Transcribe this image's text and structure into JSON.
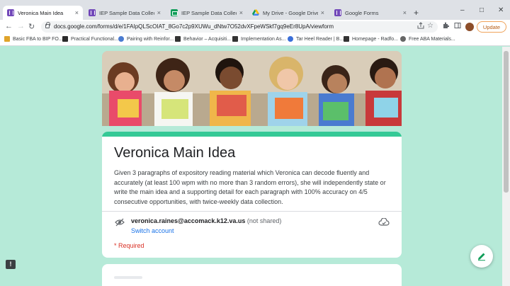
{
  "browser": {
    "tabs": [
      {
        "title": "Veronica Main Idea",
        "icon": "google-forms-icon",
        "active": true
      },
      {
        "title": "IEP Sample Data Collection",
        "icon": "google-forms-icon"
      },
      {
        "title": "IEP Sample Data Collection (",
        "icon": "google-sheets-icon"
      },
      {
        "title": "My Drive - Google Drive",
        "icon": "google-drive-icon"
      },
      {
        "title": "Google Forms",
        "icon": "google-forms-icon"
      }
    ],
    "tab_close": "×",
    "new_tab": "+",
    "window_controls": {
      "minimize": "–",
      "maximize": "□",
      "close": "✕"
    },
    "nav": {
      "back": "←",
      "forward": "→",
      "reload": "↻"
    },
    "url": "docs.google.com/forms/d/e/1FAIpQLScOIAT_8Go7c2p9XUWu_dNtw7O52dvXFpeWSkf7gq9eEr8UpA/viewform",
    "update_label": "Update",
    "bookmarks": [
      {
        "label": "Basic FBA to BIP FO...",
        "color": "#e0a42b"
      },
      {
        "label": "Practical Functional...",
        "color": "#2b2b2b"
      },
      {
        "label": "Pairing with Reinfor...",
        "color": "#4a7bd0"
      },
      {
        "label": "Behavior – Acquisiti...",
        "color": "#333333"
      },
      {
        "label": "Implementation As...",
        "color": "#333333"
      },
      {
        "label": "Tar Heel Reader | B...",
        "color": "#3b6fd8"
      },
      {
        "label": "Homepage - Radfo...",
        "color": "#333333"
      },
      {
        "label": "Free ABA Materials...",
        "color": "#666666"
      }
    ]
  },
  "form": {
    "title": "Veronica Main Idea",
    "description": "Given 3 paragraphs of expository reading material which Veronica can decode fluently and accurately (at least 100 wpm with no more than 3 random errors), she will independently state or write the main idea and a supporting detail for each paragraph with 100% accuracy on 4/5 consecutive opportunities, with twice-weekly data collection.",
    "account_email": "veronica.raines@accomack.k12.va.us",
    "not_shared": "(not shared)",
    "switch_account": "Switch account",
    "required_note": "* Required",
    "theme_color": "#35c996",
    "background_color": "#b6ead8"
  },
  "feedback_icon_label": "!"
}
